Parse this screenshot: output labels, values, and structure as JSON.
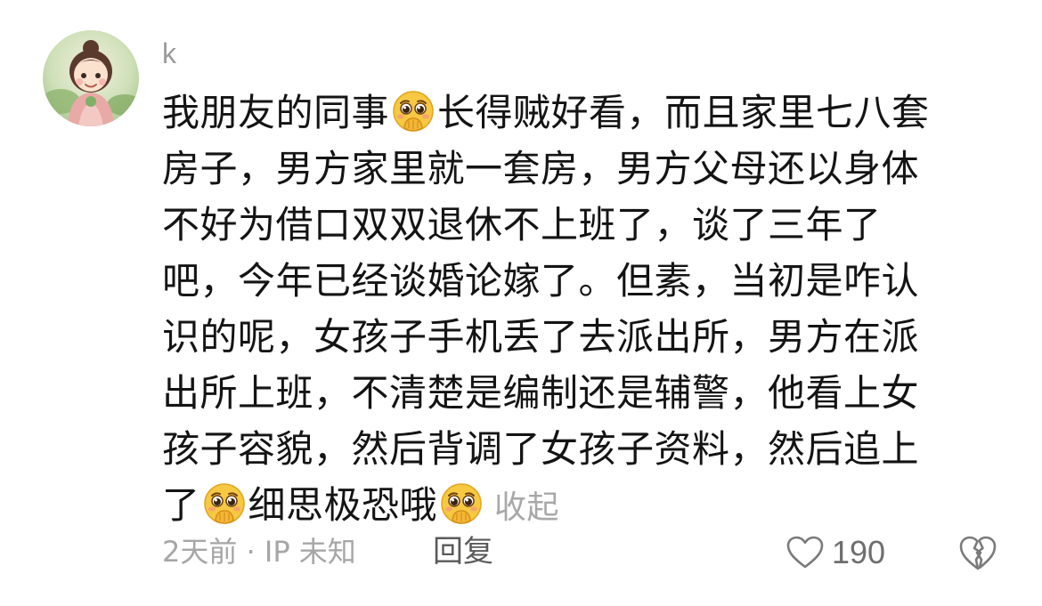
{
  "comment": {
    "username": "k",
    "avatar_icon": "avatar-illustration-icon",
    "text_lines": [
      {
        "before": "我朋友的同事",
        "emoji": "pleading-face-emoji",
        "after": "长得贼好看，而且家里七八套"
      },
      {
        "text": "房子，男方家里就一套房，男方父母还以身体"
      },
      {
        "text": "不好为借口双双退休不上班了，谈了三年了"
      },
      {
        "text": "吧，今年已经谈婚论嫁了。但素，当初是咋认"
      },
      {
        "text": "识的呢，女孩子手机丢了去派出所，男方在派"
      },
      {
        "text": "出所上班，不清楚是编制还是辅警，他看上女"
      },
      {
        "text": "孩子容貌，然后背调了女孩子资料，然后追上"
      },
      {
        "before": "了",
        "emoji": "pleading-face-emoji",
        "middle": "细思极恐哦",
        "emoji2": "pleading-face-emoji"
      }
    ],
    "collapse_label": "收起",
    "time_location": "2天前 · IP 未知",
    "reply_label": "回复",
    "like_icon": "heart-outline-icon",
    "like_count": "190",
    "dislike_icon": "broken-heart-icon",
    "colors": {
      "text": "#141414",
      "muted": "#a6a6a6",
      "icon": "#7a7a7a",
      "emoji": "#f7c842"
    }
  }
}
